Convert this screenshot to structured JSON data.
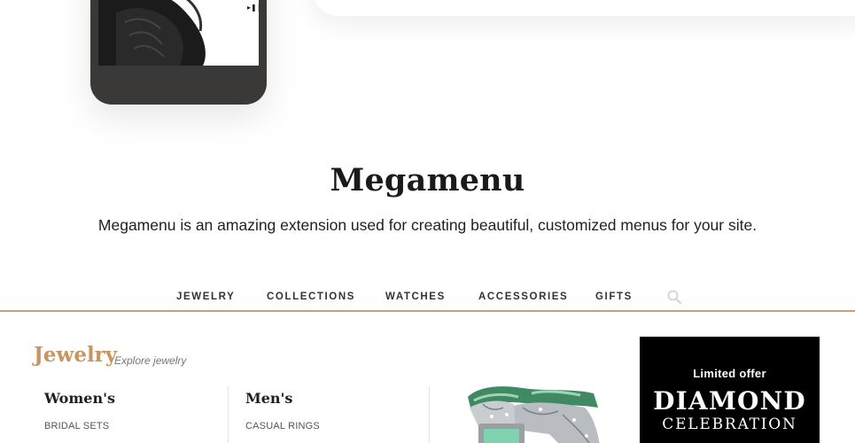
{
  "header": {
    "title": "Megamenu",
    "subtitle": "Megamenu is an amazing extension used for creating beautiful, customized menus for your site."
  },
  "nav": {
    "items": [
      "JEWELRY",
      "COLLECTIONS",
      "WATCHES",
      "ACCESSORIES",
      "GIFTS"
    ],
    "search_icon": "search-icon",
    "accent_color": "#c9a07a"
  },
  "mega": {
    "title": "Jewelry",
    "subtitle": "Explore jewelry",
    "columns": [
      {
        "heading": "Women's",
        "links": [
          "BRIDAL SETS"
        ]
      },
      {
        "heading": "Men's",
        "links": [
          "CASUAL RINGS"
        ]
      }
    ],
    "promo": {
      "small": "Limited offer",
      "big": "DIAMOND",
      "mid": "CELEBRATION"
    }
  },
  "phone": {
    "controls": "▸❚❚"
  }
}
